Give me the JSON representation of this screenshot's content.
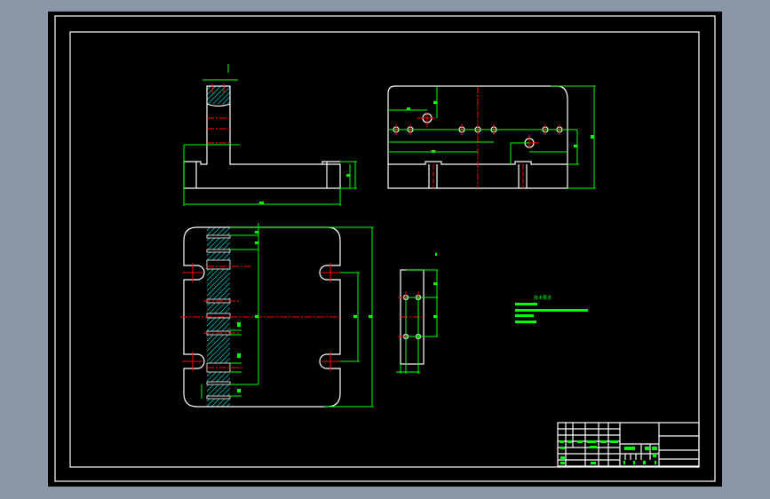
{
  "viewport": {
    "background": "#8a97a8",
    "drawing_area": "#000000"
  },
  "colors": {
    "outline": "#ffffff",
    "dimension": "#00ff00",
    "centerline": "#ff0000",
    "hatch": "#00ffff"
  },
  "views": [
    "front-view",
    "side-view",
    "plan-view",
    "detail-part"
  ],
  "notes": {
    "heading": "技术要求"
  }
}
